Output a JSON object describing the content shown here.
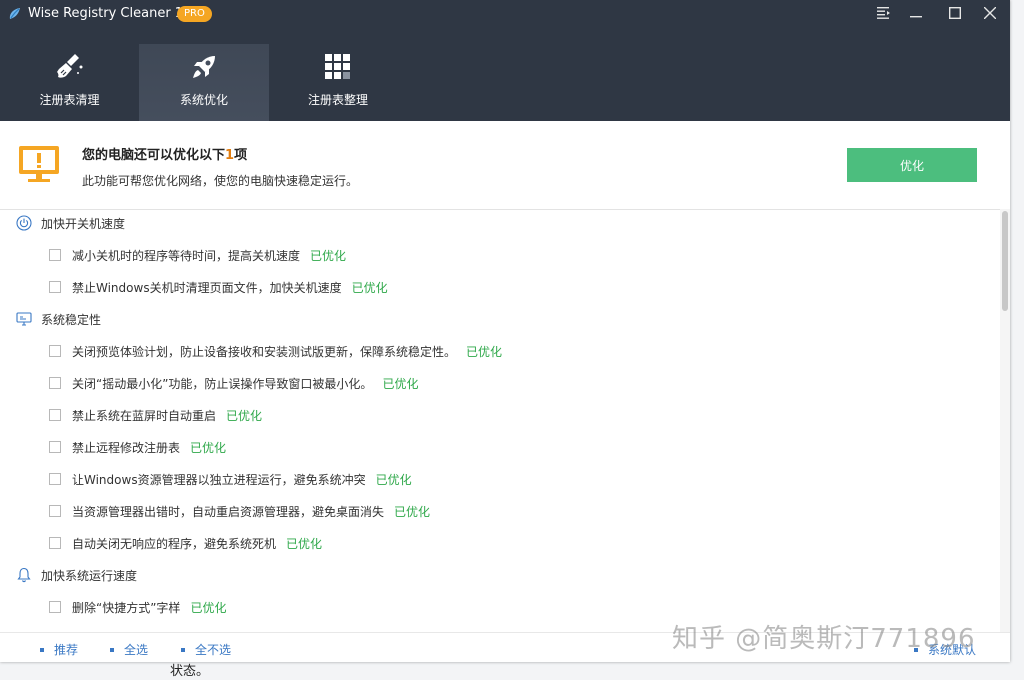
{
  "app": {
    "title": "Wise Registry Cleaner 11",
    "badge": "PRO",
    "colors": {
      "header": "#2f3744",
      "accent": "#4cbe7e",
      "badge": "#f5a623",
      "status": "#2fa84a",
      "link": "#3a78c4"
    }
  },
  "window_controls": {
    "menu_icon": "menu-icon",
    "minimize_icon": "minimize-icon",
    "maximize_icon": "maximize-icon",
    "close_icon": "close-icon"
  },
  "tabs": [
    {
      "label": "注册表清理",
      "icon": "broom-icon",
      "active": false
    },
    {
      "label": "系统优化",
      "icon": "rocket-icon",
      "active": true
    },
    {
      "label": "注册表整理",
      "icon": "grid-icon",
      "active": false
    }
  ],
  "summary": {
    "title_prefix": "您的电脑还可以优化以下",
    "count": "1",
    "title_suffix": "项",
    "description": "此功能可帮您优化网络，使您的电脑快速稳定运行。",
    "button_label": "优化",
    "icon": "monitor-alert-icon"
  },
  "sections": [
    {
      "label": "加快开关机速度",
      "icon": "power-icon",
      "items": [
        {
          "text": "减小关机时的程序等待时间，提高关机速度",
          "status": "已优化"
        },
        {
          "text": "禁止Windows关机时清理页面文件，加快关机速度",
          "status": "已优化"
        }
      ]
    },
    {
      "label": "系统稳定性",
      "icon": "monitor-icon",
      "items": [
        {
          "text": "关闭预览体验计划，防止设备接收和安装测试版更新，保障系统稳定性。",
          "status": "已优化"
        },
        {
          "text": "关闭“摇动最小化”功能，防止误操作导致窗口被最小化。",
          "status": "已优化"
        },
        {
          "text": "禁止系统在蓝屏时自动重启",
          "status": "已优化"
        },
        {
          "text": "禁止远程修改注册表",
          "status": "已优化"
        },
        {
          "text": "让Windows资源管理器以独立进程运行，避免系统冲突",
          "status": "已优化"
        },
        {
          "text": "当资源管理器出错时，自动重启资源管理器，避免桌面消失",
          "status": "已优化"
        },
        {
          "text": "自动关闭无响应的程序，避免系统死机",
          "status": "已优化"
        }
      ]
    },
    {
      "label": "加快系统运行速度",
      "icon": "bell-icon",
      "items": [
        {
          "text": "删除“快捷方式”字样",
          "status": "已优化"
        }
      ]
    }
  ],
  "footer": {
    "recommend": "推荐",
    "select_all": "全选",
    "select_none": "全不选",
    "system_default": "系统默认"
  },
  "below_text": "状态。",
  "watermark": "知乎 @简奥斯汀771896"
}
